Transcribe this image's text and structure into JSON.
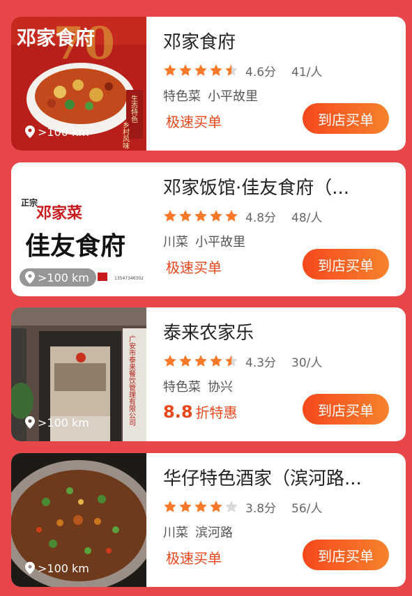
{
  "colors": {
    "page_bg": "#E8474A",
    "star_on": "#F7792A",
    "star_off": "#D9D9D9",
    "promo_text": "#E8471C",
    "button_gradient": [
      "#F5481C",
      "#F7822D"
    ]
  },
  "icons": {
    "distance": "location-pin-icon",
    "rating": "star-icon"
  },
  "restaurants": [
    {
      "name": "邓家食府",
      "rating_value": 4.6,
      "score": "4.6分",
      "price": "41/人",
      "tags": [
        "特色菜",
        "小平故里"
      ],
      "promo": {
        "highlight": "",
        "text": "极速买单"
      },
      "distance": ">100 km",
      "button": "到店买单",
      "image_text": {
        "sign": "邓家食府",
        "side1": "生态特色",
        "side2": "乡村风味"
      }
    },
    {
      "name": "邓家饭馆·佳友食府（...",
      "rating_value": 4.8,
      "score": "4.8分",
      "price": "48/人",
      "tags": [
        "川菜",
        "小平故里"
      ],
      "promo": {
        "highlight": "",
        "text": "极速买单"
      },
      "distance": ">100 km",
      "button": "到店买单",
      "image_text": {
        "stamp": "正宗",
        "line1": "邓家菜",
        "line2": "佳友食府",
        "phone": "13547346302"
      }
    },
    {
      "name": "泰来农家乐",
      "rating_value": 4.3,
      "score": "4.3分",
      "price": "30/人",
      "tags": [
        "特色菜",
        "协兴"
      ],
      "promo": {
        "highlight": "8.8",
        "text": "折特惠"
      },
      "distance": ">100 km",
      "button": "到店买单",
      "image_text": {
        "plaque": "广安市泰来餐饮管理有限公司"
      }
    },
    {
      "name": "华仔特色酒家（滨河路...",
      "rating_value": 3.8,
      "score": "3.8分",
      "price": "56/人",
      "tags": [
        "川菜",
        "滨河路"
      ],
      "promo": {
        "highlight": "",
        "text": "极速买单"
      },
      "distance": ">100 km",
      "button": "到店买单"
    }
  ]
}
